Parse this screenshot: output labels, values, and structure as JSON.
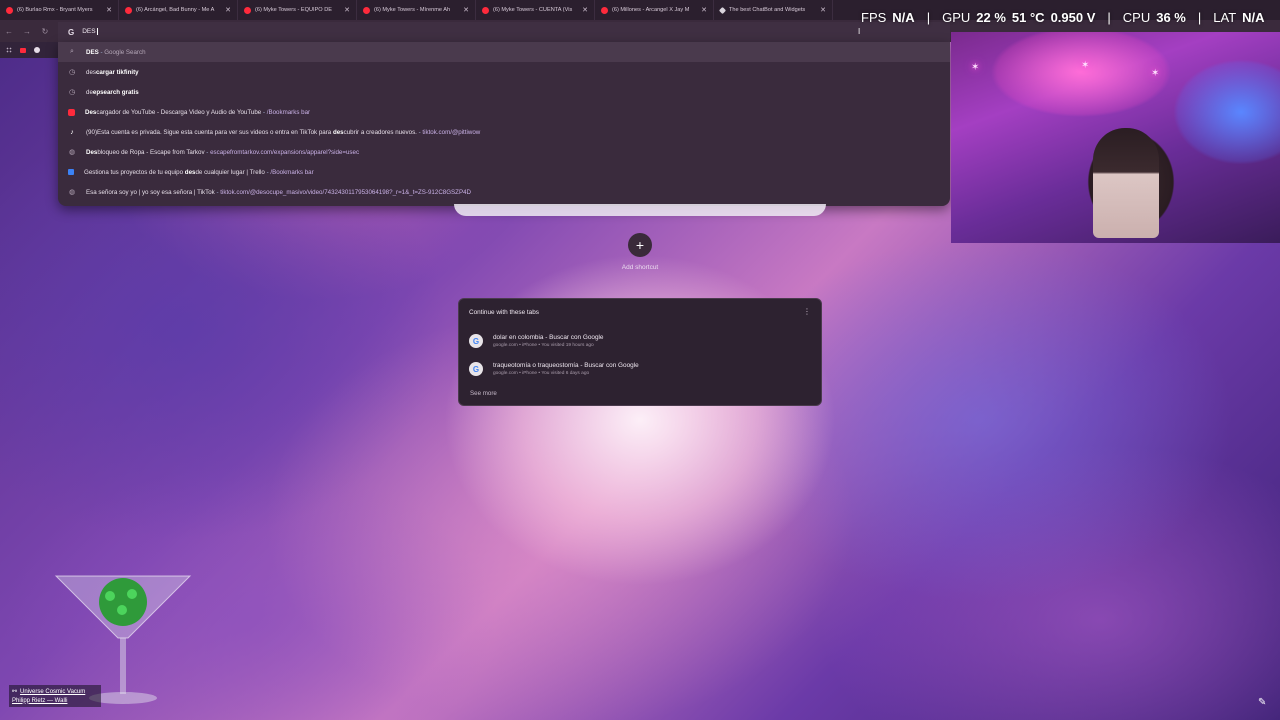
{
  "tabs": [
    {
      "title": "(6) Burlao Rmx - Bryant Myers",
      "icon": "youtube-icon"
    },
    {
      "title": "(6) Arcángel, Bad Bunny - Me A",
      "icon": "youtube-icon"
    },
    {
      "title": "(6) Myke Towers - EQUIPO DE",
      "icon": "youtube-icon"
    },
    {
      "title": "(6) Myke Towers - Mírenme Ah",
      "icon": "youtube-icon"
    },
    {
      "title": "(6) Myke Towers - CUENTA (Vis",
      "icon": "youtube-icon"
    },
    {
      "title": "(6) Millones - Arcangel X Jay M",
      "icon": "youtube-icon"
    },
    {
      "title": "The best ChatBot and Widgets",
      "icon": "chatbot-icon"
    }
  ],
  "omnibox": {
    "value": "DES"
  },
  "suggestions": [
    {
      "icon": "search-icon",
      "bold": "DES",
      "rest": "",
      "sep": " - ",
      "detail": "Google Search",
      "detail_style": "dim"
    },
    {
      "icon": "history-icon",
      "bold": "",
      "prefix": "des",
      "rest": "cargar tikfinity",
      "sep": "",
      "detail": ""
    },
    {
      "icon": "history-icon",
      "bold": "",
      "prefix": "de",
      "rest": "epsearch gratis",
      "sep": "",
      "detail": ""
    },
    {
      "icon": "youtube-icon",
      "bold": "Des",
      "rest": "cargador de YouTube - Descarga Video y Audio de YouTube",
      "sep": " - ",
      "detail": "/Bookmarks bar"
    },
    {
      "icon": "tiktok-icon",
      "bold": "",
      "prefix": "(90)Esta cuenta es privada. Sigue esta cuenta para ver sus videos o entra en TikTok para ",
      "mid_bold": "des",
      "rest": "cubrir a creadores nuevos.",
      "sep": " - ",
      "detail": "tiktok.com/@pittiwow"
    },
    {
      "icon": "globe-icon",
      "bold": "Des",
      "rest": "bloqueo de Ropa - Escape from Tarkov",
      "sep": " - ",
      "detail": "escapefromtarkov.com/expansions/apparel?side=usec"
    },
    {
      "icon": "trello-icon",
      "bold": "",
      "prefix": "Gestiona tus proyectos de tu equipo ",
      "mid_bold": "des",
      "rest": "de cualquier lugar | Trello",
      "sep": " - ",
      "detail": "/Bookmarks bar"
    },
    {
      "icon": "globe-icon",
      "bold": "",
      "prefix": "Esa señora soy yo | yo soy esa señora | TikTok",
      "rest": "",
      "sep": " - ",
      "detail": "tiktok.com/@desocupe_masivo/video/7432430117953064198?_r=1&_t=ZS-912C8GSZP4D"
    }
  ],
  "new_tab": {
    "add_shortcut_label": "Add shortcut",
    "continue_header": "Continue with these tabs",
    "items": [
      {
        "title": "dolar en colombia - Buscar con Google",
        "sub": "google.com • iPhone • You visited 19 hours ago"
      },
      {
        "title": "traqueotomía o traqueostomía - Buscar con Google",
        "sub": "google.com • iPhone • You visited 6 days ago"
      }
    ],
    "see_more": "See more"
  },
  "stats": {
    "fps_label": "FPS",
    "fps_value": "N/A",
    "gpu_label": "GPU",
    "gpu_value": "22 %",
    "gpu_temp": "51 °C",
    "gpu_volt": "0.950 V",
    "cpu_label": "CPU",
    "cpu_value": "36 %",
    "lat_label": "LAT",
    "lat_value": "N/A"
  },
  "now_playing": {
    "title": "Universe Cosmic Vacum",
    "artist": "Philipp Rietz — Walli"
  },
  "colors": {
    "youtube": "#ff2a3c",
    "accent_link": "#c9b1e6",
    "dropdown_bg": "#3a2b3d"
  }
}
